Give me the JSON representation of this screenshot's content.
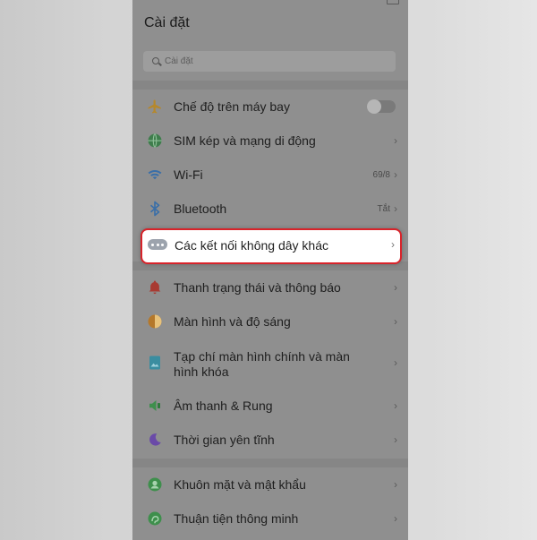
{
  "header": {
    "title": "Cài đặt"
  },
  "search": {
    "placeholder": "Cài đặt"
  },
  "items": [
    {
      "label": "Chế độ trên máy bay",
      "value": "",
      "toggle": "off"
    },
    {
      "label": "SIM kép và mạng di động",
      "value": ""
    },
    {
      "label": "Wi-Fi",
      "value": "69/8"
    },
    {
      "label": "Bluetooth",
      "value": "Tắt"
    },
    {
      "label": "Các kết nối không dây khác",
      "value": ""
    },
    {
      "label": "Thanh trạng thái và thông báo",
      "value": ""
    },
    {
      "label": "Màn hình và độ sáng",
      "value": ""
    },
    {
      "label": "Tạp chí màn hình chính và màn hình khóa",
      "value": ""
    },
    {
      "label": "Âm thanh & Rung",
      "value": ""
    },
    {
      "label": "Thời gian yên tĩnh",
      "value": ""
    },
    {
      "label": "Khuôn mặt và mật khẩu",
      "value": ""
    },
    {
      "label": "Thuận tiện thông minh",
      "value": ""
    }
  ],
  "chevron": "›",
  "icons": [
    "airplane-icon",
    "sim-icon",
    "wifi-icon",
    "bluetooth-icon",
    "wireless-dots-icon",
    "bell-icon",
    "brightness-icon",
    "image-icon",
    "speaker-icon",
    "moon-icon",
    "face-icon",
    "smart-icon"
  ],
  "colors": {
    "highlight_border": "#d8232a",
    "overlay": "#8f8f8f"
  }
}
